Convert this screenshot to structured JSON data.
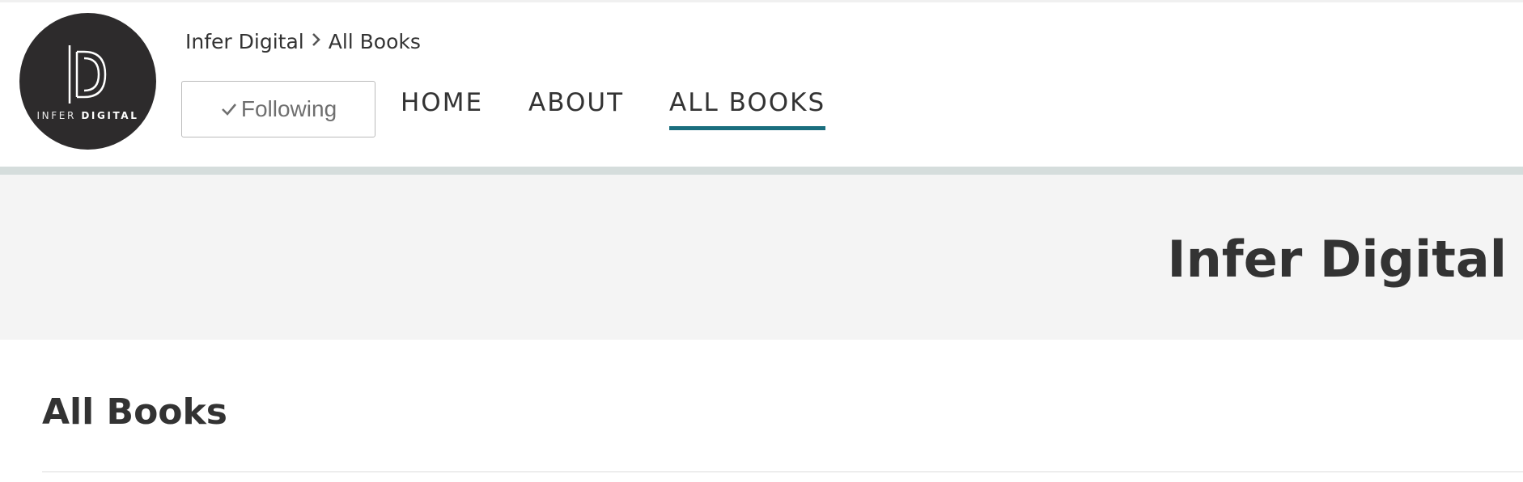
{
  "brand": {
    "logo_text_light": "INFER",
    "logo_text_bold": "DIGITAL",
    "logo_bg_color": "#2d2b2c"
  },
  "breadcrumb": {
    "items": [
      "Infer Digital",
      "All Books"
    ],
    "separator_icon": "chevron-right-icon"
  },
  "follow_button": {
    "icon": "check-icon",
    "label": "Following"
  },
  "nav": {
    "items": [
      {
        "label": "HOME",
        "active": false
      },
      {
        "label": "ABOUT",
        "active": false
      },
      {
        "label": "ALL BOOKS",
        "active": true
      }
    ],
    "active_color": "#1a6e7e"
  },
  "hero": {
    "title": "Infer Digital",
    "background_color": "#f4f4f4"
  },
  "section": {
    "title": "All Books"
  }
}
